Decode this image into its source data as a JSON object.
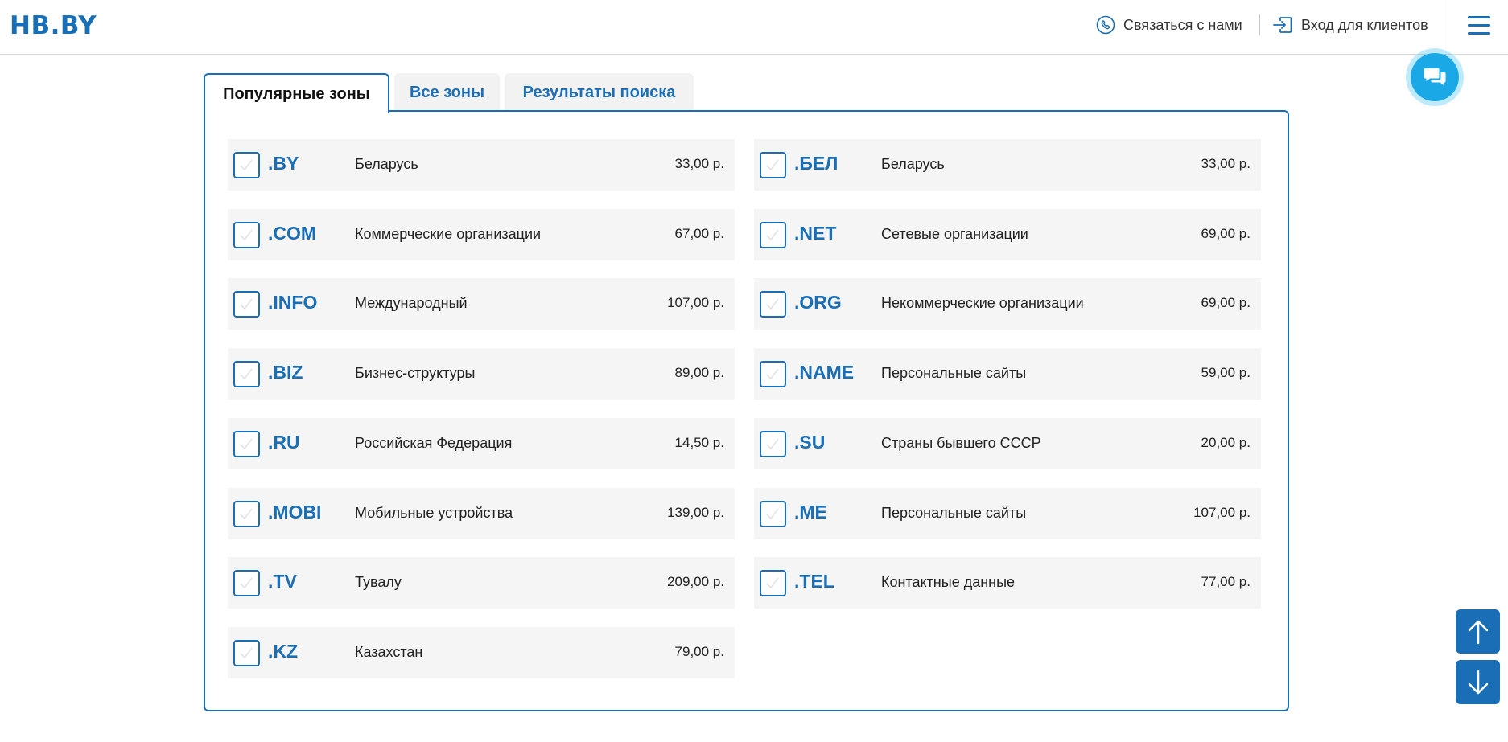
{
  "header": {
    "logo": "HB.BY",
    "contact_label": "Связаться с нами",
    "login_label": "Вход для клиентов"
  },
  "tabs": [
    {
      "label": "Популярные зоны",
      "active": true
    },
    {
      "label": "Все зоны",
      "active": false
    },
    {
      "label": "Результаты поиска",
      "active": false
    }
  ],
  "zones": [
    {
      "zone": ".BY",
      "desc": "Беларусь",
      "price": "33,00 р."
    },
    {
      "zone": ".БЕЛ",
      "desc": "Беларусь",
      "price": "33,00 р."
    },
    {
      "zone": ".COM",
      "desc": "Коммерческие организации",
      "price": "67,00 р."
    },
    {
      "zone": ".NET",
      "desc": "Сетевые организации",
      "price": "69,00 р."
    },
    {
      "zone": ".INFO",
      "desc": "Международный",
      "price": "107,00 р."
    },
    {
      "zone": ".ORG",
      "desc": "Некоммерческие организации",
      "price": "69,00 р."
    },
    {
      "zone": ".BIZ",
      "desc": "Бизнес-структуры",
      "price": "89,00 р."
    },
    {
      "zone": ".NAME",
      "desc": "Персональные сайты",
      "price": "59,00 р."
    },
    {
      "zone": ".RU",
      "desc": "Российская Федерация",
      "price": "14,50 р."
    },
    {
      "zone": ".SU",
      "desc": "Страны бывшего СССР",
      "price": "20,00 р."
    },
    {
      "zone": ".MOBI",
      "desc": "Мобильные устройства",
      "price": "139,00 р."
    },
    {
      "zone": ".ME",
      "desc": "Персональные сайты",
      "price": "107,00 р."
    },
    {
      "zone": ".TV",
      "desc": "Тувалу",
      "price": "209,00 р."
    },
    {
      "zone": ".TEL",
      "desc": "Контактные данные",
      "price": "77,00 р."
    },
    {
      "zone": ".KZ",
      "desc": "Казахстан",
      "price": "79,00 р."
    }
  ],
  "colors": {
    "brand_blue": "#1a6eb5",
    "chat_blue": "#1aa9e6",
    "row_bg": "#f5f5f5"
  },
  "icons": {
    "contact": "phone-icon",
    "login": "login-icon",
    "menu": "hamburger-menu-icon",
    "chat": "chat-bubbles-icon",
    "scroll_up": "arrow-up-icon",
    "scroll_down": "arrow-down-icon"
  }
}
